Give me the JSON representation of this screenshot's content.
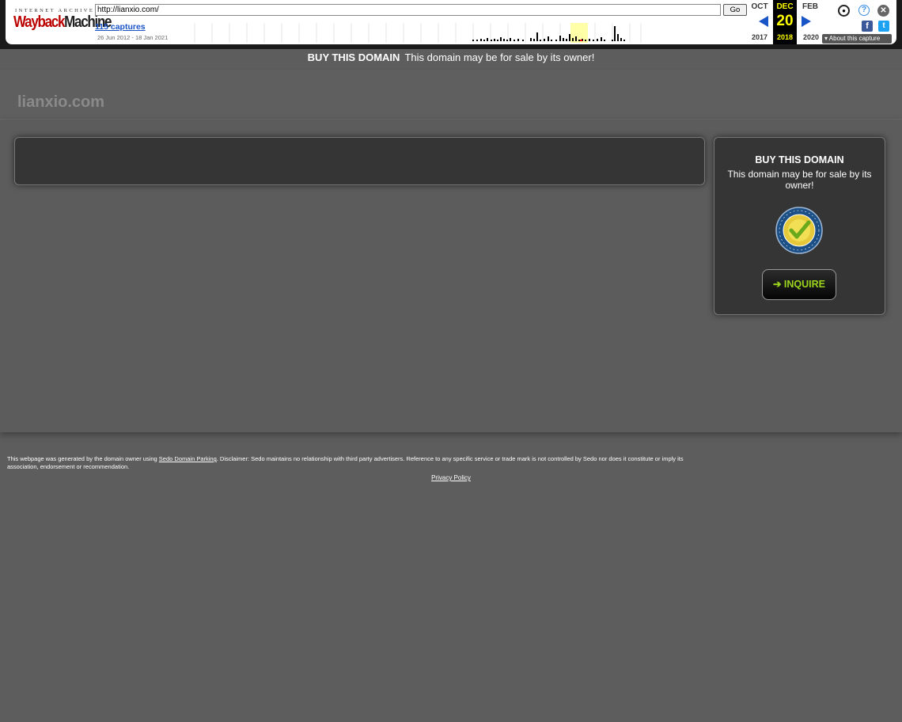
{
  "wayback": {
    "logo_top": "INTERNET ARCHIVE",
    "logo_wayback": "Wayback",
    "logo_machine": "Machine",
    "url": "http://lianxio.com/",
    "go_label": "Go",
    "captures": "115 captures",
    "range": "26 Jun 2012 - 18 Jan 2021",
    "prev_month": "OCT",
    "cur_month": "DEC",
    "next_month": "FEB",
    "cur_day": "20",
    "prev_year": "2017",
    "cur_year": "2018",
    "next_year": "2020",
    "about": "About this capture",
    "icons": [
      "user-icon",
      "help-icon",
      "close-icon",
      "facebook-icon",
      "twitter-icon"
    ]
  },
  "banner": {
    "bold": "BUY THIS DOMAIN",
    "text": "This domain may be for sale by its owner!"
  },
  "header": {
    "title": "lianxio.com"
  },
  "sidebar_box": {
    "heading": "BUY THIS DOMAIN",
    "text": "This domain may be for sale by its owner!",
    "inquire": "INQUIRE"
  },
  "footer": {
    "pre": "This webpage was generated by the domain owner using ",
    "link": "Sedo Domain Parking",
    "post": ". Disclaimer: Sedo maintains no relationship with third party advertisers. Reference to any specific service or trade mark is not controlled by Sedo nor does it constitute or imply its association, endorsement or recommendation.",
    "privacy": "Privacy Policy"
  },
  "colors": {
    "accent_green": "#9cd41c",
    "wayback_blue": "#1a55c8",
    "wayback_yellow": "#ffff00"
  }
}
